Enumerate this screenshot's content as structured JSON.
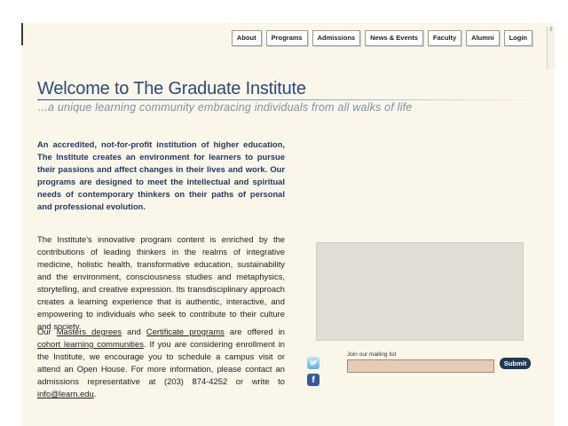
{
  "nav": {
    "items": [
      "About",
      "Programs",
      "Admissions",
      "News & Events",
      "Faculty",
      "Alumni",
      "Login"
    ]
  },
  "header": {
    "title": "Welcome to The Graduate Institute",
    "subtitle": "...a unique learning community embracing individuals from all walks of life"
  },
  "intro": {
    "text": "An accredited, not-for-profit institution of higher education, The Institute creates an environment for learners to pursue their passions and affect changes in their lives and work. Our programs are designed to meet the intellectual and spiritual needs of contemporary thinkers on their paths of personal and professional evolution."
  },
  "content": {
    "paragraph1": "The Institute's innovative program content is enriched by the contributions of leading thinkers in the realms of integrative medicine, holistic health, transformative education, sustainability and the environment, consciousness studies and metaphysics, storytelling, and creative expression.  Its transdisciplinary approach creates a learning experience that is authentic, interactive, and empowering to individuals who seek to contribute to their culture and society.",
    "p2_a": "Our ",
    "p2_link_masters": "Masters degrees",
    "p2_b": " and ",
    "p2_link_certificate": "Certificate programs",
    "p2_c": " are offered in ",
    "p2_link_cohort": "cohort learning communities",
    "p2_d": ".  If you are considering enrollment in the Institute, we encourage you to schedule a campus visit or attend an Open House.  For more information, please contact an admissions representative at (203) 874-4252 or write to ",
    "p2_link_email": "info@learn.edu",
    "p2_e": "."
  },
  "social": {
    "twitter_icon": "twitter-icon",
    "facebook_icon": "facebook-icon",
    "facebook_glyph": "f"
  },
  "mailing": {
    "label": "Join our mailing list",
    "value": "",
    "submit_label": "Submit"
  },
  "colors": {
    "background": "#fbf6ea",
    "title": "#2c4a78",
    "intro": "#243a66",
    "submit": "#1f3a57",
    "input": "#e6ccb6"
  }
}
